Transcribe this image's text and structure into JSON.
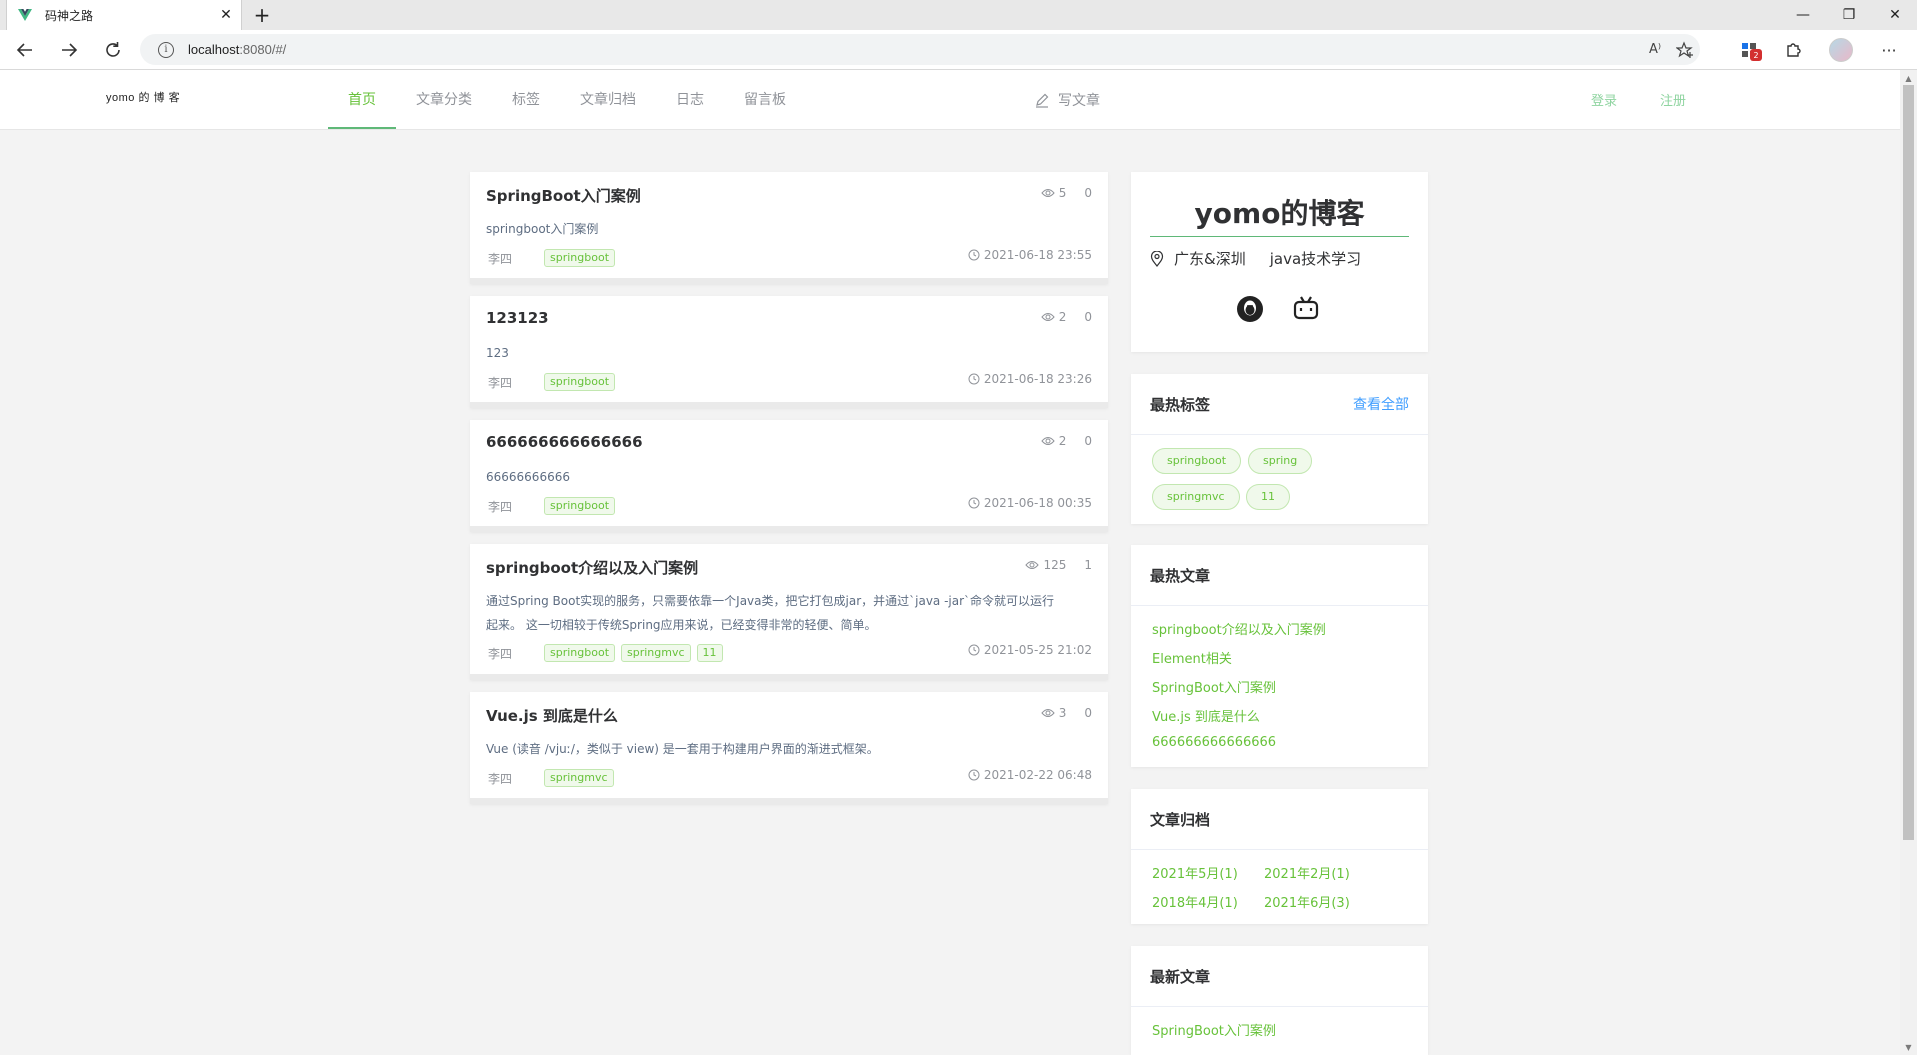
{
  "browser": {
    "tab_title": "码神之路",
    "url_host": "localhost",
    "url_rest": ":8080/#/",
    "extension_badge": "2",
    "read_aloud": "A⁾"
  },
  "site": {
    "logo": "yomo 的 博 客",
    "nav": [
      "首页",
      "文章分类",
      "标签",
      "文章归档",
      "日志",
      "留言板"
    ],
    "active_nav": "首页",
    "write": "写文章",
    "login": "登录",
    "register": "注册",
    "accent_color": "#67c23a"
  },
  "articles": [
    {
      "title": "SpringBoot入门案例",
      "views": "5",
      "comments": "0",
      "summary": "springboot入门案例",
      "author": "李四",
      "tags": [
        "springboot"
      ],
      "date": "2021-06-18 23:55"
    },
    {
      "title": "123123",
      "views": "2",
      "comments": "0",
      "summary": "123",
      "author": "李四",
      "tags": [
        "springboot"
      ],
      "date": "2021-06-18 23:26"
    },
    {
      "title": "666666666666666",
      "views": "2",
      "comments": "0",
      "summary": "66666666666",
      "author": "李四",
      "tags": [
        "springboot"
      ],
      "date": "2021-06-18 00:35"
    },
    {
      "title": "springboot介绍以及入门案例",
      "views": "125",
      "comments": "1",
      "summary_line1": "通过Spring Boot实现的服务，只需要依靠一个Java类，把它打包成jar，并通过`java -jar`命令就可以运行",
      "summary_line2": "起来。 这一切相较于传统Spring应用来说，已经变得非常的轻便、简单。",
      "author": "李四",
      "tags": [
        "springboot",
        "springmvc",
        "11"
      ],
      "date": "2021-05-25 21:02"
    },
    {
      "title": "Vue.js 到底是什么",
      "views": "3",
      "comments": "0",
      "summary": "Vue (读音 /vjuː/，类似于 view) 是一套用于构建用户界面的渐进式框架。",
      "author": "李四",
      "tags": [
        "springmvc"
      ],
      "date": "2021-02-22 06:48"
    }
  ],
  "profile": {
    "name": "yomo的博客",
    "location": "广东&深圳",
    "motto": "java技术学习",
    "social": [
      "qq-icon",
      "bilibili-icon"
    ]
  },
  "hot_tags": {
    "title": "最热标签",
    "more": "查看全部",
    "tags": [
      "springboot",
      "spring",
      "springmvc",
      "11"
    ]
  },
  "hot_articles": {
    "title": "最热文章",
    "items": [
      "springboot介绍以及入门案例",
      "Element相关",
      "SpringBoot入门案例",
      "Vue.js 到底是什么",
      "666666666666666"
    ]
  },
  "archives": {
    "title": "文章归档",
    "items": [
      "2021年5月(1)",
      "2021年2月(1)",
      "2018年4月(1)",
      "2021年6月(3)"
    ]
  },
  "new_articles": {
    "title": "最新文章",
    "items": [
      "SpringBoot入门案例"
    ]
  }
}
